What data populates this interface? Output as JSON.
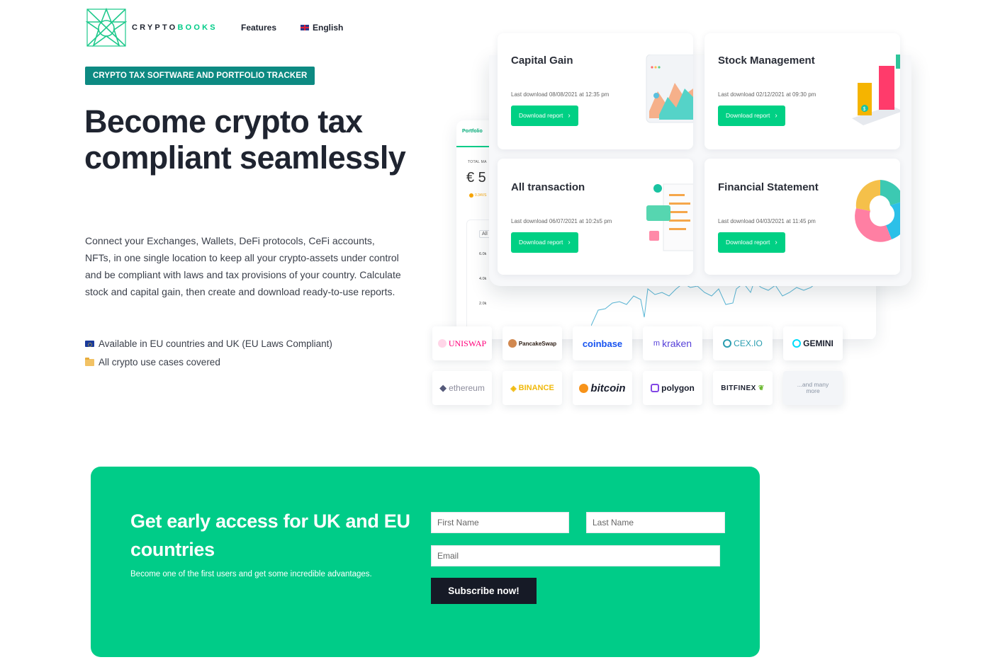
{
  "header": {
    "logo_text_dark": "CRYPTO",
    "logo_text_accent": "BOOKS",
    "nav": {
      "features": "Features",
      "language": "English"
    }
  },
  "hero": {
    "badge": "CRYPTO TAX SOFTWARE AND PORTFOLIO TRACKER",
    "title": "Become crypto tax compliant seamlessly",
    "description": "Connect your Exchanges, Wallets, DeFi protocols, CeFi accounts, NFTs, in one single location to keep all your crypto-assets under control and be compliant with laws and tax provisions of your country. Calculate stock and capital gain, then create and download ready-to-use reports.",
    "features": [
      "Available in EU countries and UK (EU Laws Compliant)",
      "All crypto use cases covered"
    ]
  },
  "dashboard": {
    "tab": "Portfolio",
    "total_label": "TOTAL MA",
    "total_value": "€ 5",
    "coin_label": "0.34VS",
    "range_select": "All",
    "y_ticks": [
      "6.0k",
      "4.0k",
      "2.0k"
    ]
  },
  "reports": [
    {
      "title": "Capital Gain",
      "meta": "Last download 08/08/2021 at 12:35 pm",
      "button": "Download report"
    },
    {
      "title": "Stock Management",
      "meta": "Last download 02/12/2021 at 09:30 pm",
      "button": "Download report"
    },
    {
      "title": "All transaction",
      "meta": "Last download 06/07/2021 at 10:2s5 pm",
      "button": "Download report"
    },
    {
      "title": "Financial Statement",
      "meta": "Last download 04/03/2021 at 11:45 pm",
      "button": "Download report"
    }
  ],
  "exchanges": {
    "row1": [
      "UNISWAP",
      "PancakeSwap",
      "coinbase",
      "kraken",
      "CEX.IO",
      "GEMINI"
    ],
    "row2": [
      "ethereum",
      "BINANCE",
      "bitcoin",
      "polygon",
      "BITFINEX",
      "...and many more"
    ]
  },
  "signup": {
    "title": "Get early access for UK and EU countries",
    "subtitle": "Become one of the first users and get some incredible advantages.",
    "first_name_placeholder": "First Name",
    "last_name_placeholder": "Last Name",
    "email_placeholder": "Email",
    "submit": "Subscribe now!"
  },
  "colors": {
    "brand_green": "#00cc88",
    "badge_teal": "#0d8a82",
    "dark": "#161a26"
  }
}
